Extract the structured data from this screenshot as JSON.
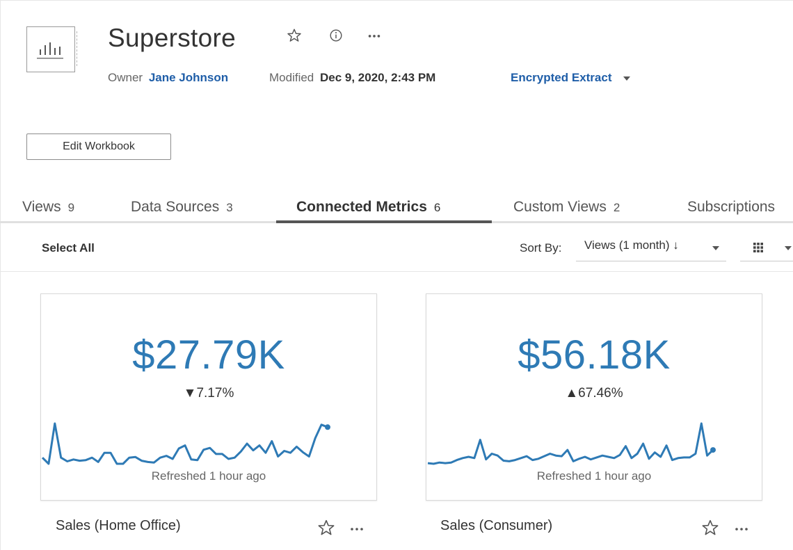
{
  "header": {
    "title": "Superstore",
    "owner_label": "Owner",
    "owner_name": "Jane Johnson",
    "modified_label": "Modified",
    "modified_value": "Dec 9, 2020, 2:43 PM",
    "extract_label": "Encrypted Extract",
    "icons": [
      "workbook-icon",
      "star-icon",
      "info-icon",
      "more-icon"
    ]
  },
  "actions": {
    "edit_workbook": "Edit Workbook"
  },
  "tabs": [
    {
      "label": "Views",
      "count": "9"
    },
    {
      "label": "Data Sources",
      "count": "3"
    },
    {
      "label": "Connected Metrics",
      "count": "6",
      "active": true
    },
    {
      "label": "Custom Views",
      "count": "2"
    },
    {
      "label": "Subscriptions",
      "count": ""
    }
  ],
  "toolbar": {
    "select_all": "Select All",
    "sort_by_label": "Sort By:",
    "sort_value": "Views (1 month) ↓",
    "view_mode_icon": "grid-icon"
  },
  "metrics": [
    {
      "value": "$27.79K",
      "change": "▼7.17%",
      "trend": [
        3,
        2,
        8.6,
        3,
        2.4,
        2.7,
        2.5,
        2.6,
        3,
        2.3,
        3.8,
        3.8,
        2,
        2,
        3,
        3.1,
        2.5,
        2.3,
        2.2,
        3,
        3.3,
        2.8,
        4.5,
        5,
        2.7,
        2.6,
        4.3,
        4.6,
        3.6,
        3.6,
        2.8,
        3,
        4,
        5.3,
        4.2,
        5,
        3.8,
        5.7,
        3.2,
        4.1,
        3.8,
        4.8,
        3.9,
        3.2,
        6.2,
        8.4,
        8
      ],
      "refreshed": "Refreshed 1 hour ago",
      "name": "Sales (Home Office)"
    },
    {
      "value": "$56.18K",
      "change": "▲67.46%",
      "trend": [
        1.5,
        1.4,
        1.6,
        1.5,
        1.6,
        2,
        2.3,
        2.5,
        2.3,
        5.2,
        2.1,
        3,
        2.7,
        1.9,
        1.8,
        2,
        2.3,
        2.6,
        2,
        2.2,
        2.6,
        3,
        2.7,
        2.6,
        3.6,
        1.8,
        2.2,
        2.5,
        2.1,
        2.4,
        2.7,
        2.5,
        2.3,
        2.8,
        4.2,
        2.3,
        3,
        4.6,
        2.2,
        3.2,
        2.5,
        4.3,
        2,
        2.3,
        2.4,
        2.4,
        3,
        7.8,
        2.7,
        3.6
      ],
      "refreshed": "Refreshed 1 hour ago",
      "name": "Sales (Consumer)"
    }
  ],
  "colors": {
    "accent": "#2e7ab5",
    "link": "#1f5ea8",
    "active_tab_underline": "#555555"
  }
}
